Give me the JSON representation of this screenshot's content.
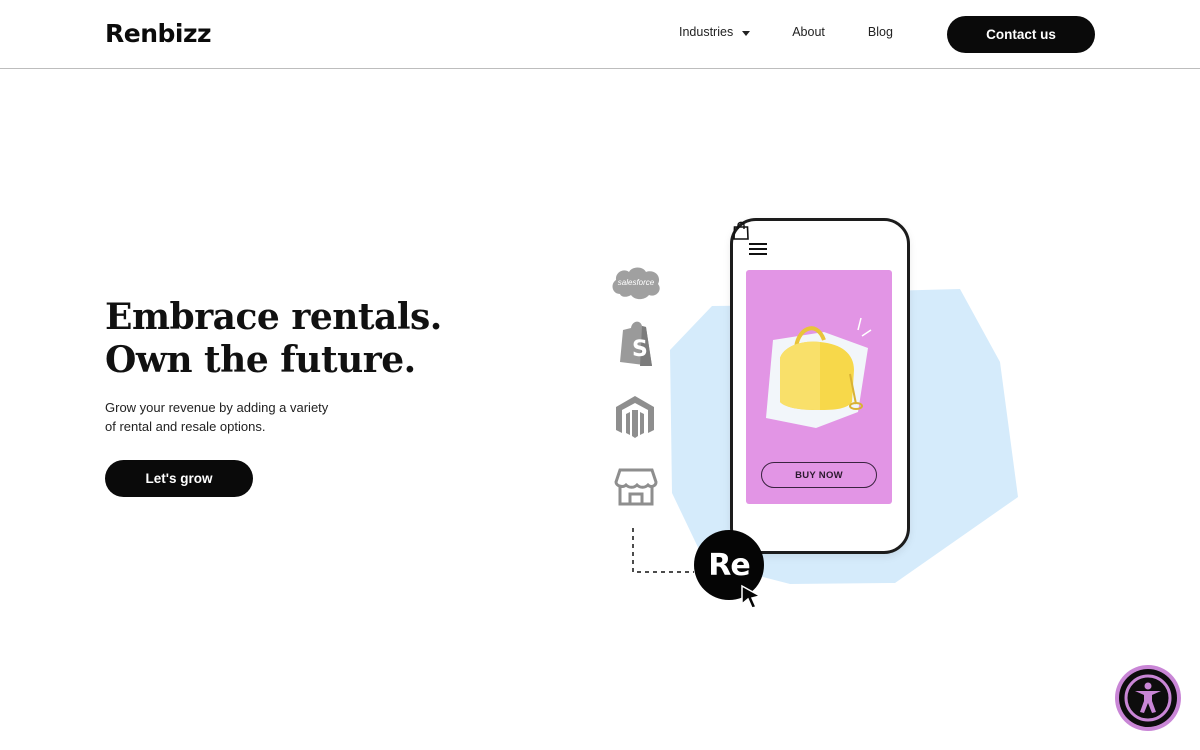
{
  "header": {
    "logo": "Renbizz",
    "nav": {
      "industries": "Industries",
      "about": "About",
      "blog": "Blog"
    },
    "contact_label": "Contact us"
  },
  "hero": {
    "title_line1": "Embrace rentals.",
    "title_line2": "Own the future.",
    "subtitle_line1": "Grow your revenue by adding a variety",
    "subtitle_line2": "of rental and resale options.",
    "cta_label": "Let's grow"
  },
  "illustration": {
    "integrations": [
      "salesforce",
      "shopify-icon",
      "magento-icon",
      "storefront-icon"
    ],
    "salesforce_label": "salesforce",
    "phone": {
      "buy_label": "BUY NOW"
    },
    "badge_label": "Re"
  },
  "colors": {
    "accent_blue": "#d5ebfb",
    "screen_pink": "#e295e5",
    "bag_yellow": "#f7d84a",
    "a11y_ring": "#c986d6"
  },
  "accessibility": {
    "icon": "accessibility-icon"
  }
}
